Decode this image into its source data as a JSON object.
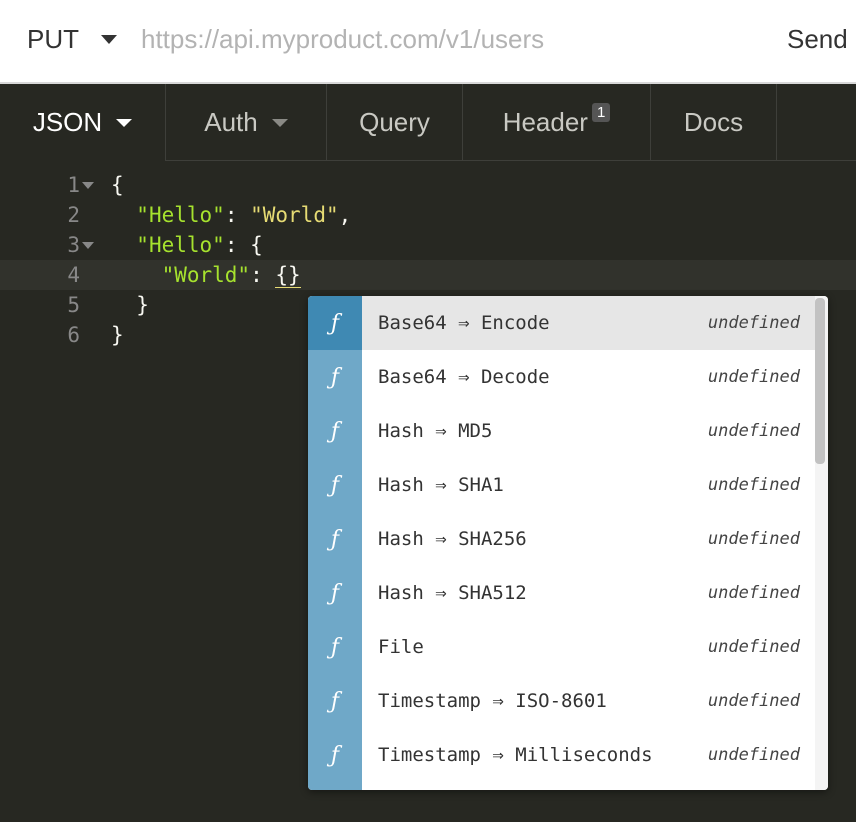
{
  "request": {
    "method": "PUT",
    "url_placeholder": "https://api.myproduct.com/v1/users",
    "send_label": "Send"
  },
  "tabs": [
    {
      "label": "JSON",
      "active": true
    },
    {
      "label": "Auth"
    },
    {
      "label": "Query"
    },
    {
      "label": "Header",
      "badge": "1"
    },
    {
      "label": "Docs"
    }
  ],
  "editor": {
    "lines": [
      {
        "num": "1"
      },
      {
        "num": "2"
      },
      {
        "num": "3"
      },
      {
        "num": "4"
      },
      {
        "num": "5"
      },
      {
        "num": "6"
      }
    ],
    "tokens": {
      "open_brace": "{",
      "key1": "\"Hello\"",
      "val1": "\"World\"",
      "colon": ": ",
      "comma": ",",
      "key2": "\"Hello\"",
      "open_brace2": "{",
      "key3": "\"World\"",
      "empty_obj": "{}",
      "close_brace_inner": "}",
      "close_brace": "}"
    }
  },
  "autocomplete": {
    "items": [
      {
        "icon": "ƒ",
        "label": "Base64 ⇒ Encode",
        "detail": "undefined",
        "selected": true
      },
      {
        "icon": "ƒ",
        "label": "Base64 ⇒ Decode",
        "detail": "undefined"
      },
      {
        "icon": "ƒ",
        "label": "Hash ⇒ MD5",
        "detail": "undefined"
      },
      {
        "icon": "ƒ",
        "label": "Hash ⇒ SHA1",
        "detail": "undefined"
      },
      {
        "icon": "ƒ",
        "label": "Hash ⇒ SHA256",
        "detail": "undefined"
      },
      {
        "icon": "ƒ",
        "label": "Hash ⇒ SHA512",
        "detail": "undefined"
      },
      {
        "icon": "ƒ",
        "label": "File",
        "detail": "undefined"
      },
      {
        "icon": "ƒ",
        "label": "Timestamp ⇒ ISO-8601",
        "detail": "undefined"
      },
      {
        "icon": "ƒ",
        "label": "Timestamp ⇒ Milliseconds",
        "detail": "undefined"
      }
    ]
  },
  "colors": {
    "editor_bg": "#272822",
    "key_green": "#a6e22e",
    "string_yellow": "#e6db74",
    "ac_icon_blue": "#6fa8c8",
    "ac_icon_selected": "#3f89b3"
  }
}
